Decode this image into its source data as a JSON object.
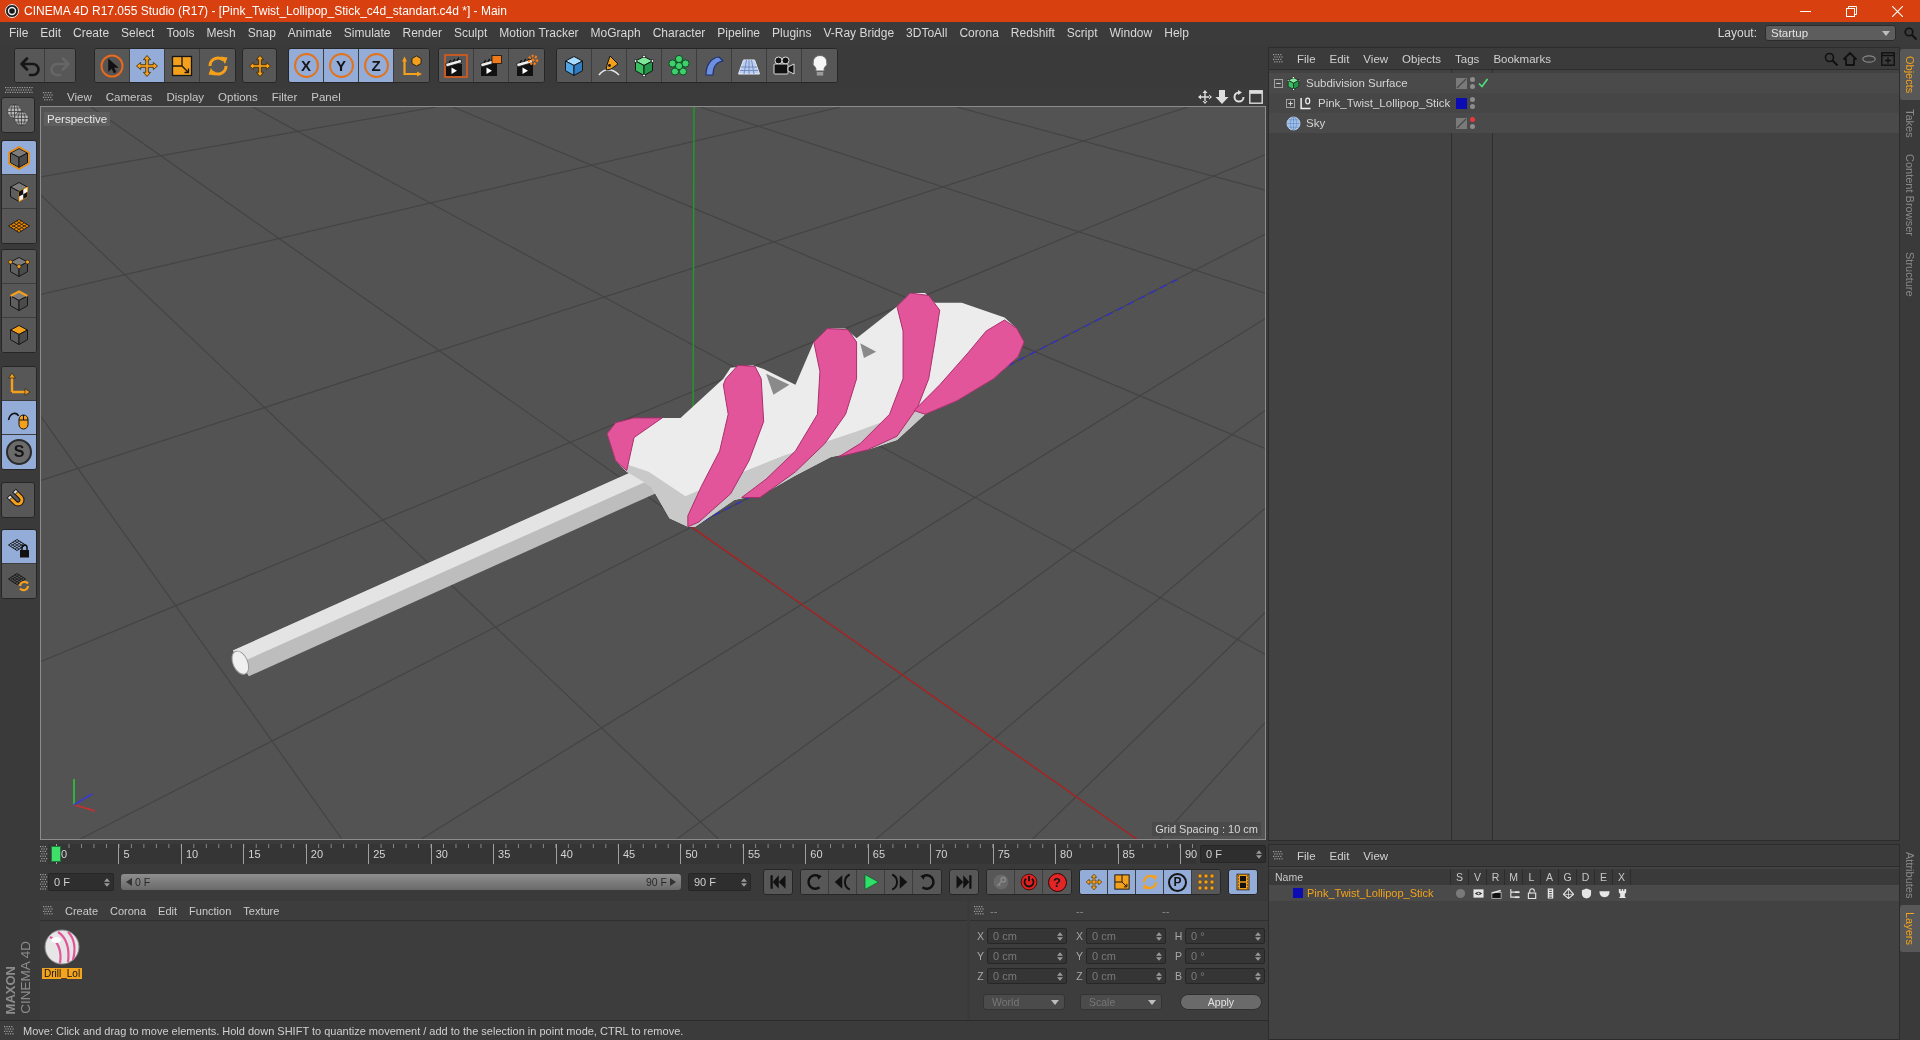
{
  "window": {
    "title": "CINEMA 4D R17.055 Studio (R17) - [Pink_Twist_Lollipop_Stick_c4d_standart.c4d *] - Main"
  },
  "menu_bar": {
    "items": [
      "File",
      "Edit",
      "Create",
      "Select",
      "Tools",
      "Mesh",
      "Snap",
      "Animate",
      "Simulate",
      "Render",
      "Sculpt",
      "Motion Tracker",
      "MoGraph",
      "Character",
      "Pipeline",
      "Plugins",
      "V-Ray Bridge",
      "3DToAll",
      "Corona",
      "Redshift",
      "Script",
      "Window",
      "Help"
    ],
    "layout_label": "Layout:",
    "layout_value": "Startup"
  },
  "toolbar": {
    "groups": [
      {
        "buttons": [
          {
            "kind": "undo",
            "disabled": false
          },
          {
            "kind": "redo",
            "disabled": true
          }
        ]
      },
      {
        "buttons": [
          {
            "kind": "select",
            "on": false
          },
          {
            "kind": "move",
            "on": true
          },
          {
            "kind": "scale",
            "on": false
          },
          {
            "kind": "rotate",
            "on": false
          }
        ]
      },
      {
        "buttons": [
          {
            "kind": "move",
            "on": false
          }
        ]
      },
      {
        "buttons": [
          {
            "kind": "axis",
            "label": "X",
            "on": true
          },
          {
            "kind": "axis",
            "label": "Y",
            "on": true
          },
          {
            "kind": "axis",
            "label": "Z",
            "on": true
          },
          {
            "kind": "coords",
            "on": false
          }
        ]
      },
      {
        "buttons": [
          {
            "kind": "render",
            "on": false
          },
          {
            "kind": "renderpv",
            "on": false
          },
          {
            "kind": "rendersettings",
            "on": false
          }
        ]
      },
      {
        "buttons": [
          {
            "kind": "cube",
            "on": false
          },
          {
            "kind": "pen",
            "on": false
          },
          {
            "kind": "subdivision",
            "on": false
          },
          {
            "kind": "cloner",
            "on": false
          },
          {
            "kind": "bend",
            "on": false
          },
          {
            "kind": "floor",
            "on": false
          },
          {
            "kind": "camera",
            "on": false
          },
          {
            "kind": "light",
            "on": false
          }
        ]
      }
    ]
  },
  "tool_palette": {
    "groups": [
      {
        "buttons": [
          {
            "kind": "editable",
            "on": false
          }
        ]
      },
      {
        "buttons": [
          {
            "kind": "model",
            "on": true
          },
          {
            "kind": "texture",
            "on": false
          },
          {
            "kind": "workplane",
            "on": false
          }
        ]
      },
      {
        "buttons": [
          {
            "kind": "points",
            "on": false
          },
          {
            "kind": "edges",
            "on": false
          },
          {
            "kind": "polygons",
            "on": false
          }
        ]
      },
      {
        "buttons": [
          {
            "kind": "axis",
            "on": false
          },
          {
            "kind": "tweak",
            "on": true
          },
          {
            "kind": "snap",
            "label": "S",
            "on": true
          }
        ]
      },
      {
        "buttons": [
          {
            "kind": "magnet",
            "on": false
          }
        ]
      },
      {
        "buttons": [
          {
            "kind": "lockplane",
            "on": true
          },
          {
            "kind": "alignplane",
            "on": false
          }
        ]
      }
    ]
  },
  "logo": {
    "brand": "MAXON",
    "product": "CINEMA 4D"
  },
  "viewport": {
    "menu": [
      "View",
      "Cameras",
      "Display",
      "Options",
      "Filter",
      "Panel"
    ],
    "camera": "Perspective",
    "grid_spacing": "Grid Spacing : 10 cm"
  },
  "timeline": {
    "ticks": [
      "0",
      "5",
      "10",
      "15",
      "20",
      "25",
      "30",
      "35",
      "40",
      "45",
      "50",
      "55",
      "60",
      "65",
      "70",
      "75",
      "80",
      "85",
      "90"
    ],
    "playhead": {
      "level": 0
    },
    "current_frame": "0 F",
    "range": {
      "start": "0 F",
      "slider_start": "0 F",
      "slider_end": "90 F",
      "end": "90 F",
      "level": 1
    },
    "transport": {
      "groups": [
        {
          "buttons": [
            {
              "kind": "start",
              "on": false
            }
          ]
        },
        {
          "buttons": [
            {
              "kind": "prevkey",
              "on": false
            },
            {
              "kind": "prevframe",
              "on": false
            },
            {
              "kind": "play",
              "on": false
            },
            {
              "kind": "nextframe",
              "on": false
            },
            {
              "kind": "nextkey",
              "on": false
            }
          ]
        },
        {
          "buttons": [
            {
              "kind": "end",
              "on": false
            }
          ]
        },
        {
          "buttons": [
            {
              "kind": "key",
              "disabled": true
            },
            {
              "kind": "record",
              "disabled": false
            },
            {
              "kind": "keysel",
              "label": "?",
              "disabled": false
            }
          ]
        },
        {
          "buttons": [
            {
              "kind": "move",
              "on": true
            },
            {
              "kind": "scale",
              "on": true
            },
            {
              "kind": "rotate",
              "on": true
            },
            {
              "kind": "param",
              "label": "P",
              "on": true
            },
            {
              "kind": "pla",
              "on": false
            }
          ]
        },
        {
          "buttons": [
            {
              "kind": "film",
              "on": true
            }
          ]
        }
      ]
    }
  },
  "material_manager": {
    "menu": [
      "Create",
      "Corona",
      "Edit",
      "Function",
      "Texture"
    ],
    "materials": [
      {
        "name": "Drill_Lol",
        "selected": true
      }
    ]
  },
  "coordinates": {
    "headers": [
      "--",
      "--",
      "--"
    ],
    "disabled": true,
    "rows": [
      {
        "cells": [
          {
            "label": "X",
            "value": "0 cm"
          },
          {
            "label": "X",
            "value": "0 cm"
          },
          {
            "label": "H",
            "value": "0 °"
          }
        ]
      },
      {
        "cells": [
          {
            "label": "Y",
            "value": "0 cm"
          },
          {
            "label": "Y",
            "value": "0 cm"
          },
          {
            "label": "P",
            "value": "0 °"
          }
        ]
      },
      {
        "cells": [
          {
            "label": "Z",
            "value": "0 cm"
          },
          {
            "label": "Z",
            "value": "0 cm"
          },
          {
            "label": "B",
            "value": "0 °"
          }
        ]
      }
    ],
    "dropdowns": [
      "World",
      "Scale"
    ],
    "apply": "Apply"
  },
  "object_manager": {
    "menu": [
      "File",
      "Edit",
      "View",
      "Objects",
      "Tags",
      "Bookmarks"
    ],
    "objects": [
      {
        "name": "Subdivision Surface",
        "kind": "subdivision",
        "selected": false,
        "expanded": true,
        "check": true,
        "editor_hidden": false,
        "render_hidden": false,
        "children": [
          {
            "name": "Pink_Twist_Lollipop_Stick",
            "kind": "null",
            "selected": false,
            "expanded": false,
            "color": "#0c0cb4",
            "check": false,
            "editor_hidden": false,
            "render_hidden": false
          }
        ]
      },
      {
        "name": "Sky",
        "kind": "sky",
        "selected": false,
        "check": false,
        "editor_hidden": true,
        "render_hidden": false
      }
    ]
  },
  "layer_manager": {
    "menu": [
      "File",
      "Edit",
      "View"
    ],
    "columns": [
      "Name",
      "S",
      "V",
      "R",
      "M",
      "L",
      "A",
      "G",
      "D",
      "E",
      "X"
    ],
    "layers": [
      {
        "name": "Pink_Twist_Lollipop_Stick",
        "color": "#0c0cb4",
        "selected": true,
        "toggles": [
          {
            "kind": "solo",
            "on": false
          },
          {
            "kind": "view",
            "on": true
          },
          {
            "kind": "render",
            "on": true
          },
          {
            "kind": "manager",
            "on": true
          },
          {
            "kind": "lock",
            "on": true
          },
          {
            "kind": "animation",
            "on": true
          },
          {
            "kind": "generators",
            "on": true
          },
          {
            "kind": "deformers",
            "on": true
          },
          {
            "kind": "expressions",
            "on": true
          },
          {
            "kind": "xref",
            "on": true
          }
        ]
      }
    ]
  },
  "side_tabs": {
    "upper": [
      {
        "label": "Objects",
        "selected": true
      },
      {
        "label": "Takes",
        "selected": false
      },
      {
        "label": "Content Browser",
        "selected": false
      },
      {
        "label": "Structure",
        "selected": false
      }
    ],
    "lower": [
      {
        "label": "Attributes",
        "selected": false
      },
      {
        "label": "Layers",
        "selected": true
      }
    ]
  },
  "status_bar": {
    "text": "Move: Click and drag to move elements. Hold down SHIFT to quantize movement / add to the selection in point mode, CTRL to remove."
  }
}
